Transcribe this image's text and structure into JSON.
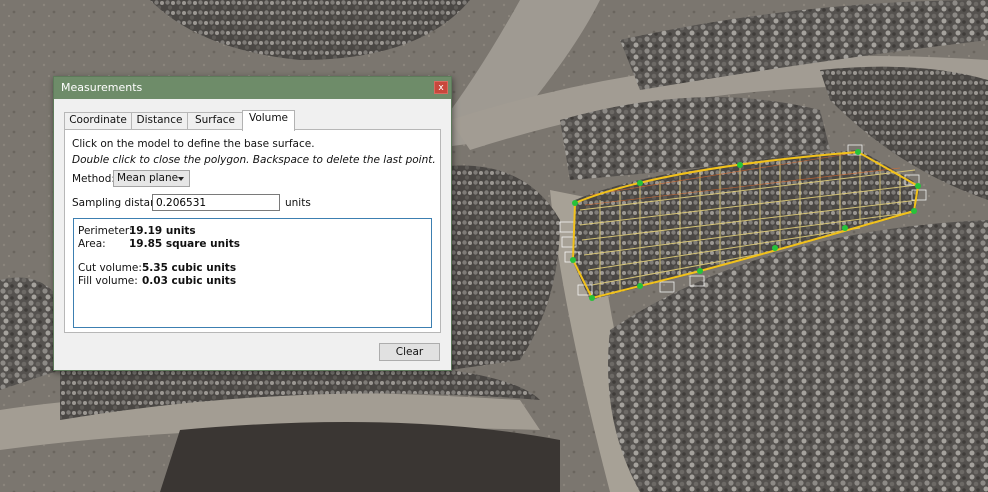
{
  "window": {
    "title": "Measurements",
    "close_label": "x"
  },
  "tabs": [
    {
      "label": "Coordinate",
      "active": false
    },
    {
      "label": "Distance",
      "active": false
    },
    {
      "label": "Surface",
      "active": false
    },
    {
      "label": "Volume",
      "active": true
    }
  ],
  "panel": {
    "hint_1": "Click on the model to define the base surface.",
    "hint_2": "Double click to close the polygon. Backspace to delete the last point.",
    "method_label": "Method:",
    "method_value": "Mean plane",
    "sampling_label": "Sampling distance:",
    "sampling_value": "0.206531",
    "sampling_unit": "units"
  },
  "results": {
    "perimeter_label": "Perimeter:",
    "perimeter_value": "19.19 units",
    "area_label": "Area:",
    "area_value": "19.85 square units",
    "cut_label": "Cut volume:",
    "cut_value": "5.35 cubic units",
    "fill_label": "Fill volume:",
    "fill_value": "0.03 cubic units"
  },
  "buttons": {
    "clear_label": "Clear"
  },
  "colors": {
    "titlebar": "#6e8c69",
    "close_button": "#c8473c",
    "results_border": "#3c7fb1",
    "polygon_line": "#f2c21a",
    "vertex_marker": "#27c23a"
  },
  "scene": {
    "description_icon": "terrain-3d-model"
  }
}
